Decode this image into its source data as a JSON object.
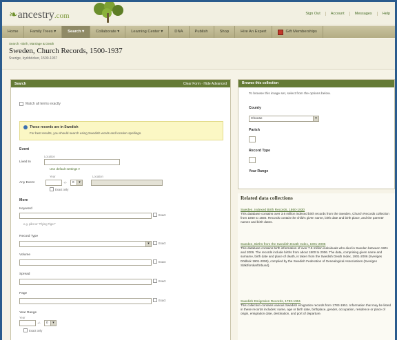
{
  "topbar": {
    "logo_text": "ancestry",
    "logo_suffix": ".com",
    "links": [
      "Sign Out",
      "Account",
      "Messages",
      "Help"
    ]
  },
  "nav": {
    "items": [
      "Home",
      "Family Trees ▾",
      "Search ▾",
      "Collaborate ▾",
      "Learning Center ▾",
      "DNA",
      "Publish",
      "Shop",
      "Hire An Expert",
      "Gift Memberships"
    ]
  },
  "header": {
    "breadcrumb": "Search › Birth, Marriage & Death",
    "title": "Sweden, Church Records, 1500-1937",
    "subtitle": "Sverige, kyrkböcker, 1500-1937"
  },
  "search_form": {
    "title": "Search",
    "header_links": "Clear Form · Hide Advanced",
    "match_exactly": "Match all terms exactly",
    "notice_title": "These records are in Swedish",
    "notice_body": "For best results, you should search using Swedish words and location spellings.",
    "event_heading": "Event",
    "lived_in_label": "Lived In",
    "location_hint": "Location",
    "use_default_link": "Use default settings ▾",
    "any_event_label": "Any Event",
    "year_hint": "Year",
    "plus_minus": "+/-",
    "year_range_value": "0",
    "location_hint2": "Location",
    "exact_only": "Exact only",
    "more_heading": "More",
    "keyword_label": "Keyword",
    "keyword_hint": "e.g. pilot or \"Flying Tiger\"",
    "record_type_label": "Record Type",
    "volume_label": "Volume",
    "spread_label": "Spread",
    "page_label": "Page",
    "year_range_label": "Year Range",
    "year_label": "Year",
    "exact_label": "Exact"
  },
  "browse": {
    "title": "Browse this collection",
    "intro": "To browse this image set, select from the options below.",
    "county_label": "County",
    "county_value": "Choose",
    "parish_label": "Parish",
    "record_type_label": "Record Type",
    "year_range_label": "Year Range"
  },
  "related": {
    "heading": "Related data collections",
    "items": [
      {
        "title": "Sweden, Indexed Birth Records, 1860-1930",
        "desc": "This database contains over 3.6 million indexed birth records from the Sweden, Church Records collection from 1860 to 1930. Records contain the child's given name, birth date and birth place, and the parents' names and birth dates."
      },
      {
        "title": "Sweden, Births from the Swedish Death Index, 1901-2006",
        "desc": "This database contains birth information of over 7.5 million individuals who died in Sweden between 1901 and 2006. The records include births from about 1800 to 2006. The data, comprising given name and surname, birth date and place of death, is taken from the Swedish Death Index, 1901-2006 (Sveriges Dödbok 1901-2006), compiled by the Swedish Federation of Genealogical Associations (Sveriges Släktforskarförbund)."
      },
      {
        "title": "Swedish Emigration Records, 1783-1951",
        "desc": "This collection contains various Swedish emigration records from 1783-1951. Information that may be listed in these records includes: name, age or birth date, birthplace, gender, occupation, residence or place of origin, emigration date, destination, and port of departure."
      }
    ]
  }
}
